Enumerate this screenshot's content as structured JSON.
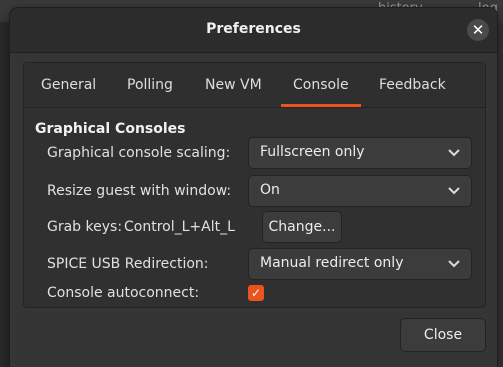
{
  "background_window": {
    "col1": "history",
    "col2": "log"
  },
  "dialog": {
    "title": "Preferences",
    "close_icon": "close-icon",
    "close_glyph": "✕"
  },
  "tabs": [
    {
      "label": "General",
      "active": false
    },
    {
      "label": "Polling",
      "active": false
    },
    {
      "label": "New VM",
      "active": false
    },
    {
      "label": "Console",
      "active": true
    },
    {
      "label": "Feedback",
      "active": false
    }
  ],
  "console": {
    "section_title": "Graphical Consoles",
    "scaling_label": "Graphical console scaling:",
    "scaling_value": "Fullscreen only",
    "resize_label": "Resize guest with window:",
    "resize_value": "On",
    "grab_keys_label": "Grab keys:",
    "grab_keys_value": "Control_L+Alt_L",
    "change_button": "Change...",
    "usb_label": "SPICE USB Redirection:",
    "usb_value": "Manual redirect only",
    "autoconnect_label": "Console autoconnect:",
    "autoconnect_checked": true,
    "check_glyph": "✓"
  },
  "footer": {
    "close_button": "Close"
  },
  "colors": {
    "accent": "#e95420",
    "dialog_bg": "#353535",
    "titlebar_bg": "#2c2c2c"
  }
}
